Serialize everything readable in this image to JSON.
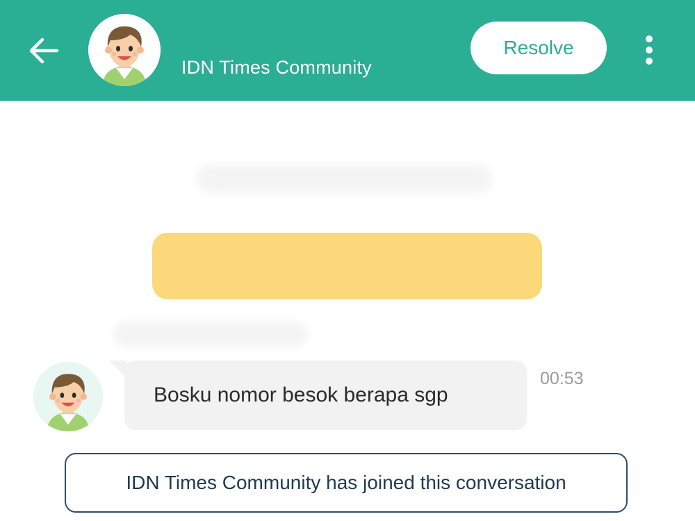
{
  "header": {
    "back_icon": "arrow-left-icon",
    "title": "IDN Times Community",
    "resolve_label": "Resolve",
    "more_icon": "vertical-dots-icon",
    "background_color": "#2aae94"
  },
  "messages": [
    {
      "text": "Bosku nomor besok berapa sgp",
      "time": "00:53",
      "avatar_icon": "user-avatar-icon"
    }
  ],
  "system_notice": {
    "text": "IDN Times Community has joined this conversation"
  },
  "colors": {
    "accent": "#2aae94",
    "banner": "#fbd97a",
    "bubble": "#f2f2f2",
    "system_border": "#2c4f68"
  }
}
